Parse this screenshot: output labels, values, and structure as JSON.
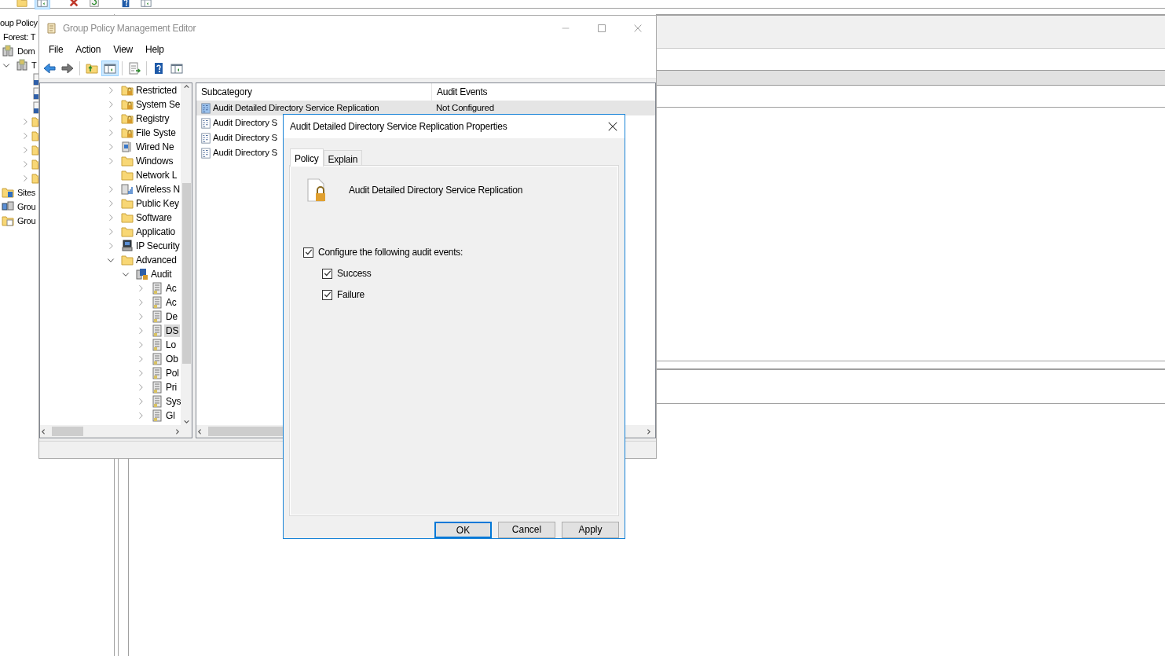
{
  "background_window": {
    "title": "oup Policy",
    "toolbar": [
      {
        "kind": "folder",
        "pressed": false
      },
      {
        "kind": "pane",
        "pressed": true
      },
      {
        "kind": "delete",
        "pressed": false
      },
      {
        "kind": "refresh",
        "pressed": false
      },
      {
        "kind": "help",
        "pressed": false
      },
      {
        "kind": "pane",
        "pressed": false
      }
    ],
    "tree": [
      {
        "label": "Forest: T",
        "kind": "forest"
      },
      {
        "label": "Dom",
        "kind": "domain"
      },
      {
        "label": "T",
        "kind": "domain",
        "expanded": true,
        "children": [
          {
            "kind": "link"
          },
          {
            "kind": "link"
          },
          {
            "kind": "link"
          },
          {
            "kind": "secfolder",
            "expanded": false
          },
          {
            "kind": "secfolder",
            "expanded": false
          },
          {
            "kind": "secfolder",
            "expanded": false
          },
          {
            "kind": "secfolder",
            "expanded": false
          },
          {
            "kind": "secfolder",
            "expanded": false
          }
        ]
      },
      {
        "label": "Sites",
        "kind": "sites"
      },
      {
        "label": "Grou",
        "kind": "modeling"
      },
      {
        "label": "Grou",
        "kind": "results"
      }
    ]
  },
  "editor": {
    "title": "Group Policy Management Editor",
    "active": false,
    "menu": [
      "File",
      "Action",
      "View",
      "Help"
    ],
    "toolbar": [
      {
        "kind": "back",
        "pressed": false
      },
      {
        "kind": "forward",
        "pressed": false
      },
      {
        "kind": "separator"
      },
      {
        "kind": "up",
        "pressed": false
      },
      {
        "kind": "pane",
        "pressed": true
      },
      {
        "kind": "separator"
      },
      {
        "kind": "export",
        "pressed": false
      },
      {
        "kind": "separator"
      },
      {
        "kind": "help",
        "pressed": false
      },
      {
        "kind": "pane",
        "pressed": false
      }
    ],
    "tree": [
      {
        "label": "Restricted",
        "kind": "secfolder",
        "expanded": false,
        "selected": false
      },
      {
        "label": "System Se",
        "kind": "secfolder",
        "expanded": false,
        "selected": false
      },
      {
        "label": "Registry",
        "kind": "secfolder",
        "expanded": false,
        "selected": false
      },
      {
        "label": "File Syste",
        "kind": "secfolder",
        "expanded": false,
        "selected": false
      },
      {
        "label": "Wired Ne",
        "kind": "wired",
        "expanded": false,
        "selected": false
      },
      {
        "label": "Windows",
        "kind": "folder",
        "expanded": false,
        "selected": false
      },
      {
        "label": "Network L",
        "kind": "folder",
        "selected": false
      },
      {
        "label": "Wireless N",
        "kind": "wireless",
        "expanded": false,
        "selected": false
      },
      {
        "label": "Public Key",
        "kind": "folder",
        "expanded": false,
        "selected": false
      },
      {
        "label": "Software",
        "kind": "folder",
        "expanded": false,
        "selected": false
      },
      {
        "label": "Applicatio",
        "kind": "folder",
        "expanded": false,
        "selected": false
      },
      {
        "label": "IP Security",
        "kind": "ipsec",
        "expanded": false,
        "selected": false
      },
      {
        "label": "Advanced",
        "kind": "folder",
        "expanded": true,
        "selected": false,
        "children": [
          {
            "label": "Audit",
            "kind": "audit",
            "expanded": true,
            "selected": false,
            "children": [
              {
                "label": "Ac",
                "kind": "category",
                "expanded": false,
                "selected": false
              },
              {
                "label": "Ac",
                "kind": "category",
                "expanded": false,
                "selected": false
              },
              {
                "label": "De",
                "kind": "category",
                "expanded": false,
                "selected": false
              },
              {
                "label": "DS",
                "kind": "category",
                "expanded": false,
                "selected": true
              },
              {
                "label": "Lo",
                "kind": "category",
                "expanded": false,
                "selected": false
              },
              {
                "label": "Ob",
                "kind": "category",
                "expanded": false,
                "selected": false
              },
              {
                "label": "Pol",
                "kind": "category",
                "expanded": false,
                "selected": false
              },
              {
                "label": "Pri",
                "kind": "category",
                "expanded": false,
                "selected": false
              },
              {
                "label": "Sys",
                "kind": "category",
                "expanded": false,
                "selected": false
              },
              {
                "label": "Gl",
                "kind": "category",
                "expanded": false,
                "selected": false
              }
            ]
          }
        ]
      }
    ],
    "list": {
      "columns": [
        "Subcategory",
        "Audit Events"
      ],
      "rows": [
        {
          "subcategory": "Audit Detailed Directory Service Replication",
          "audit_events": "Not Configured",
          "selected": true
        },
        {
          "subcategory": "Audit Directory S",
          "selected": false
        },
        {
          "subcategory": "Audit Directory S",
          "selected": false
        },
        {
          "subcategory": "Audit Directory S",
          "selected": false
        }
      ]
    }
  },
  "dialog": {
    "title": "Audit Detailed Directory Service Replication Properties",
    "tabs": [
      {
        "label": "Policy",
        "selected": true
      },
      {
        "label": "Explain",
        "selected": false
      }
    ],
    "policy_name": "Audit Detailed Directory Service Replication",
    "options": [
      {
        "kind": "parent",
        "label": "Configure the following audit events:",
        "checked": true
      },
      {
        "kind": "child",
        "label": "Success",
        "checked": true
      },
      {
        "kind": "child",
        "label": "Failure",
        "checked": true
      }
    ],
    "buttons": [
      {
        "label": "OK",
        "default": true
      },
      {
        "label": "Cancel",
        "default": false
      },
      {
        "label": "Apply",
        "default": false
      }
    ]
  }
}
